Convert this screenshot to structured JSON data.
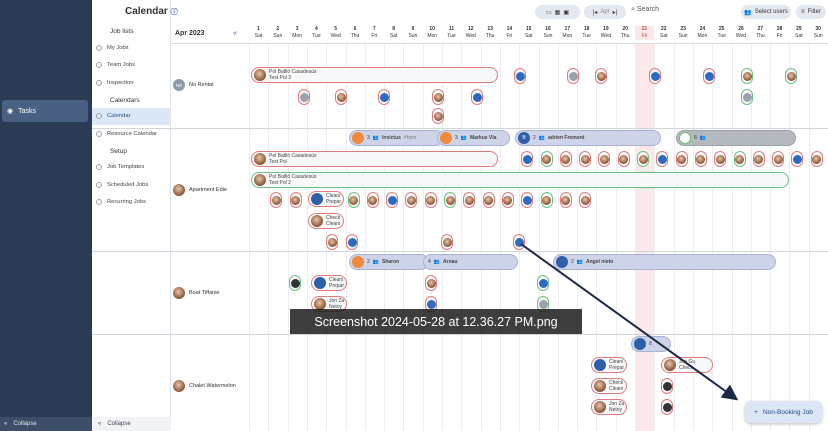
{
  "outer_sidebar": {
    "tasks_label": "Tasks",
    "collapse_label": "Collapse"
  },
  "inner_sidebar": {
    "job_lists_label": "Job lists",
    "my_jobs": "My Jobs",
    "team_jobs": "Team Jobs",
    "inspection": "Inspection",
    "calendars_label": "Calendars",
    "calendar": "Calendar",
    "resource_calendar": "Resource Calendar",
    "setup_label": "Setup",
    "job_templates": "Job Templates",
    "scheduled_jobs": "Scheduled Jobs",
    "recurring_jobs": "Recurring Jobs",
    "collapse_label": "Collapse"
  },
  "topbar": {
    "title": "Calendar",
    "view_labels": [
      "▭",
      "▦",
      "▣"
    ],
    "nav_prev": "|◂",
    "nav_mid": "Apr",
    "nav_next": "▸|",
    "search_label": "Search",
    "select_users": "Select users",
    "filter": "Filter"
  },
  "calendar": {
    "month": "Apr 2023",
    "back_arrow": "«",
    "days": [
      {
        "n": "1",
        "d": "Sat"
      },
      {
        "n": "2",
        "d": "Sun"
      },
      {
        "n": "3",
        "d": "Mon"
      },
      {
        "n": "4",
        "d": "Tue"
      },
      {
        "n": "5",
        "d": "Wed"
      },
      {
        "n": "6",
        "d": "Thu"
      },
      {
        "n": "7",
        "d": "Fri"
      },
      {
        "n": "8",
        "d": "Sat"
      },
      {
        "n": "9",
        "d": "Sun"
      },
      {
        "n": "10",
        "d": "Mon"
      },
      {
        "n": "11",
        "d": "Tue"
      },
      {
        "n": "12",
        "d": "Wed"
      },
      {
        "n": "13",
        "d": "Thu"
      },
      {
        "n": "14",
        "d": "Fri"
      },
      {
        "n": "15",
        "d": "Sat"
      },
      {
        "n": "16",
        "d": "Sun"
      },
      {
        "n": "17",
        "d": "Mon"
      },
      {
        "n": "18",
        "d": "Tue"
      },
      {
        "n": "19",
        "d": "Wed"
      },
      {
        "n": "20",
        "d": "Thu"
      },
      {
        "n": "21",
        "d": "Fri"
      },
      {
        "n": "22",
        "d": "Sat"
      },
      {
        "n": "23",
        "d": "Sun"
      },
      {
        "n": "24",
        "d": "Mon"
      },
      {
        "n": "25",
        "d": "Tue"
      },
      {
        "n": "26",
        "d": "Wed"
      },
      {
        "n": "27",
        "d": "Thu"
      },
      {
        "n": "28",
        "d": "Fri"
      },
      {
        "n": "29",
        "d": "Sat"
      },
      {
        "n": "30",
        "d": "Sun"
      }
    ],
    "highlight_day": "21"
  },
  "properties": {
    "no_rental": {
      "initials": "NR",
      "name": "No Rental"
    },
    "apartment_edie": {
      "name": "Apartment Edie"
    },
    "boat_tiffanie": {
      "name": "Boat Tiffanie"
    },
    "chalet": {
      "name": "Chalet Watermelon"
    }
  },
  "events": {
    "nr_bar": {
      "line1": "Pol Batlló Casadesús",
      "line2": "Test Pol 3"
    },
    "edie_b1": "Invictus",
    "edie_b1_count": "3",
    "edie_b1_tag": "#hom",
    "edie_b2": "Markus Vla",
    "edie_b2_count": "3",
    "edie_b3": "adrien Fremont",
    "edie_b3_count": "2",
    "edie_b3_init": "B",
    "edie_grey_count": "8",
    "edie_test1": {
      "line1": "Pol Batlló Casadesús",
      "line2": "Test Pol"
    },
    "edie_test2": {
      "line1": "Pol Batlló Casadesús",
      "line2": "Test Pol 2"
    },
    "edie_clean1": {
      "line1": "Cleani",
      "line2": "Prepar"
    },
    "edie_check": {
      "line1": "Check",
      "line2": "Cleani"
    },
    "boat_b1": "Sharon",
    "boat_b1_count": "2",
    "boat_b2": "Arnau",
    "boat_b2_count": "4",
    "boat_b3": "Angel nieto",
    "boat_b3_count": "2",
    "boat_clean": {
      "line1": "Cleani",
      "line2": "Prepar"
    },
    "boat_jon": {
      "line1": "Jon Za",
      "line2": "Netoy"
    },
    "chalet_b1_count": "8",
    "chalet_jon_gu": {
      "line1": "Jon Gu",
      "line2": "Check"
    },
    "chalet_clean": {
      "line1": "Cleani",
      "line2": "Prepar"
    },
    "chalet_check": {
      "line1": "Check",
      "line2": "Cleani"
    },
    "chalet_jon": {
      "line1": "Jon Za",
      "line2": "Netoy"
    },
    "tile_ha": "HA"
  },
  "overlay": {
    "screenshot_label": "Screenshot 2024-05-28 at 12.36.27 PM.png"
  },
  "fab": {
    "label": "Non-Booking Job"
  },
  "colors": {
    "sidebar": "#2b3b53",
    "accent": "#1f4e8a",
    "event_red": "#e07b7b",
    "event_green": "#6cc27d",
    "highlight": "#fbe9ea"
  }
}
